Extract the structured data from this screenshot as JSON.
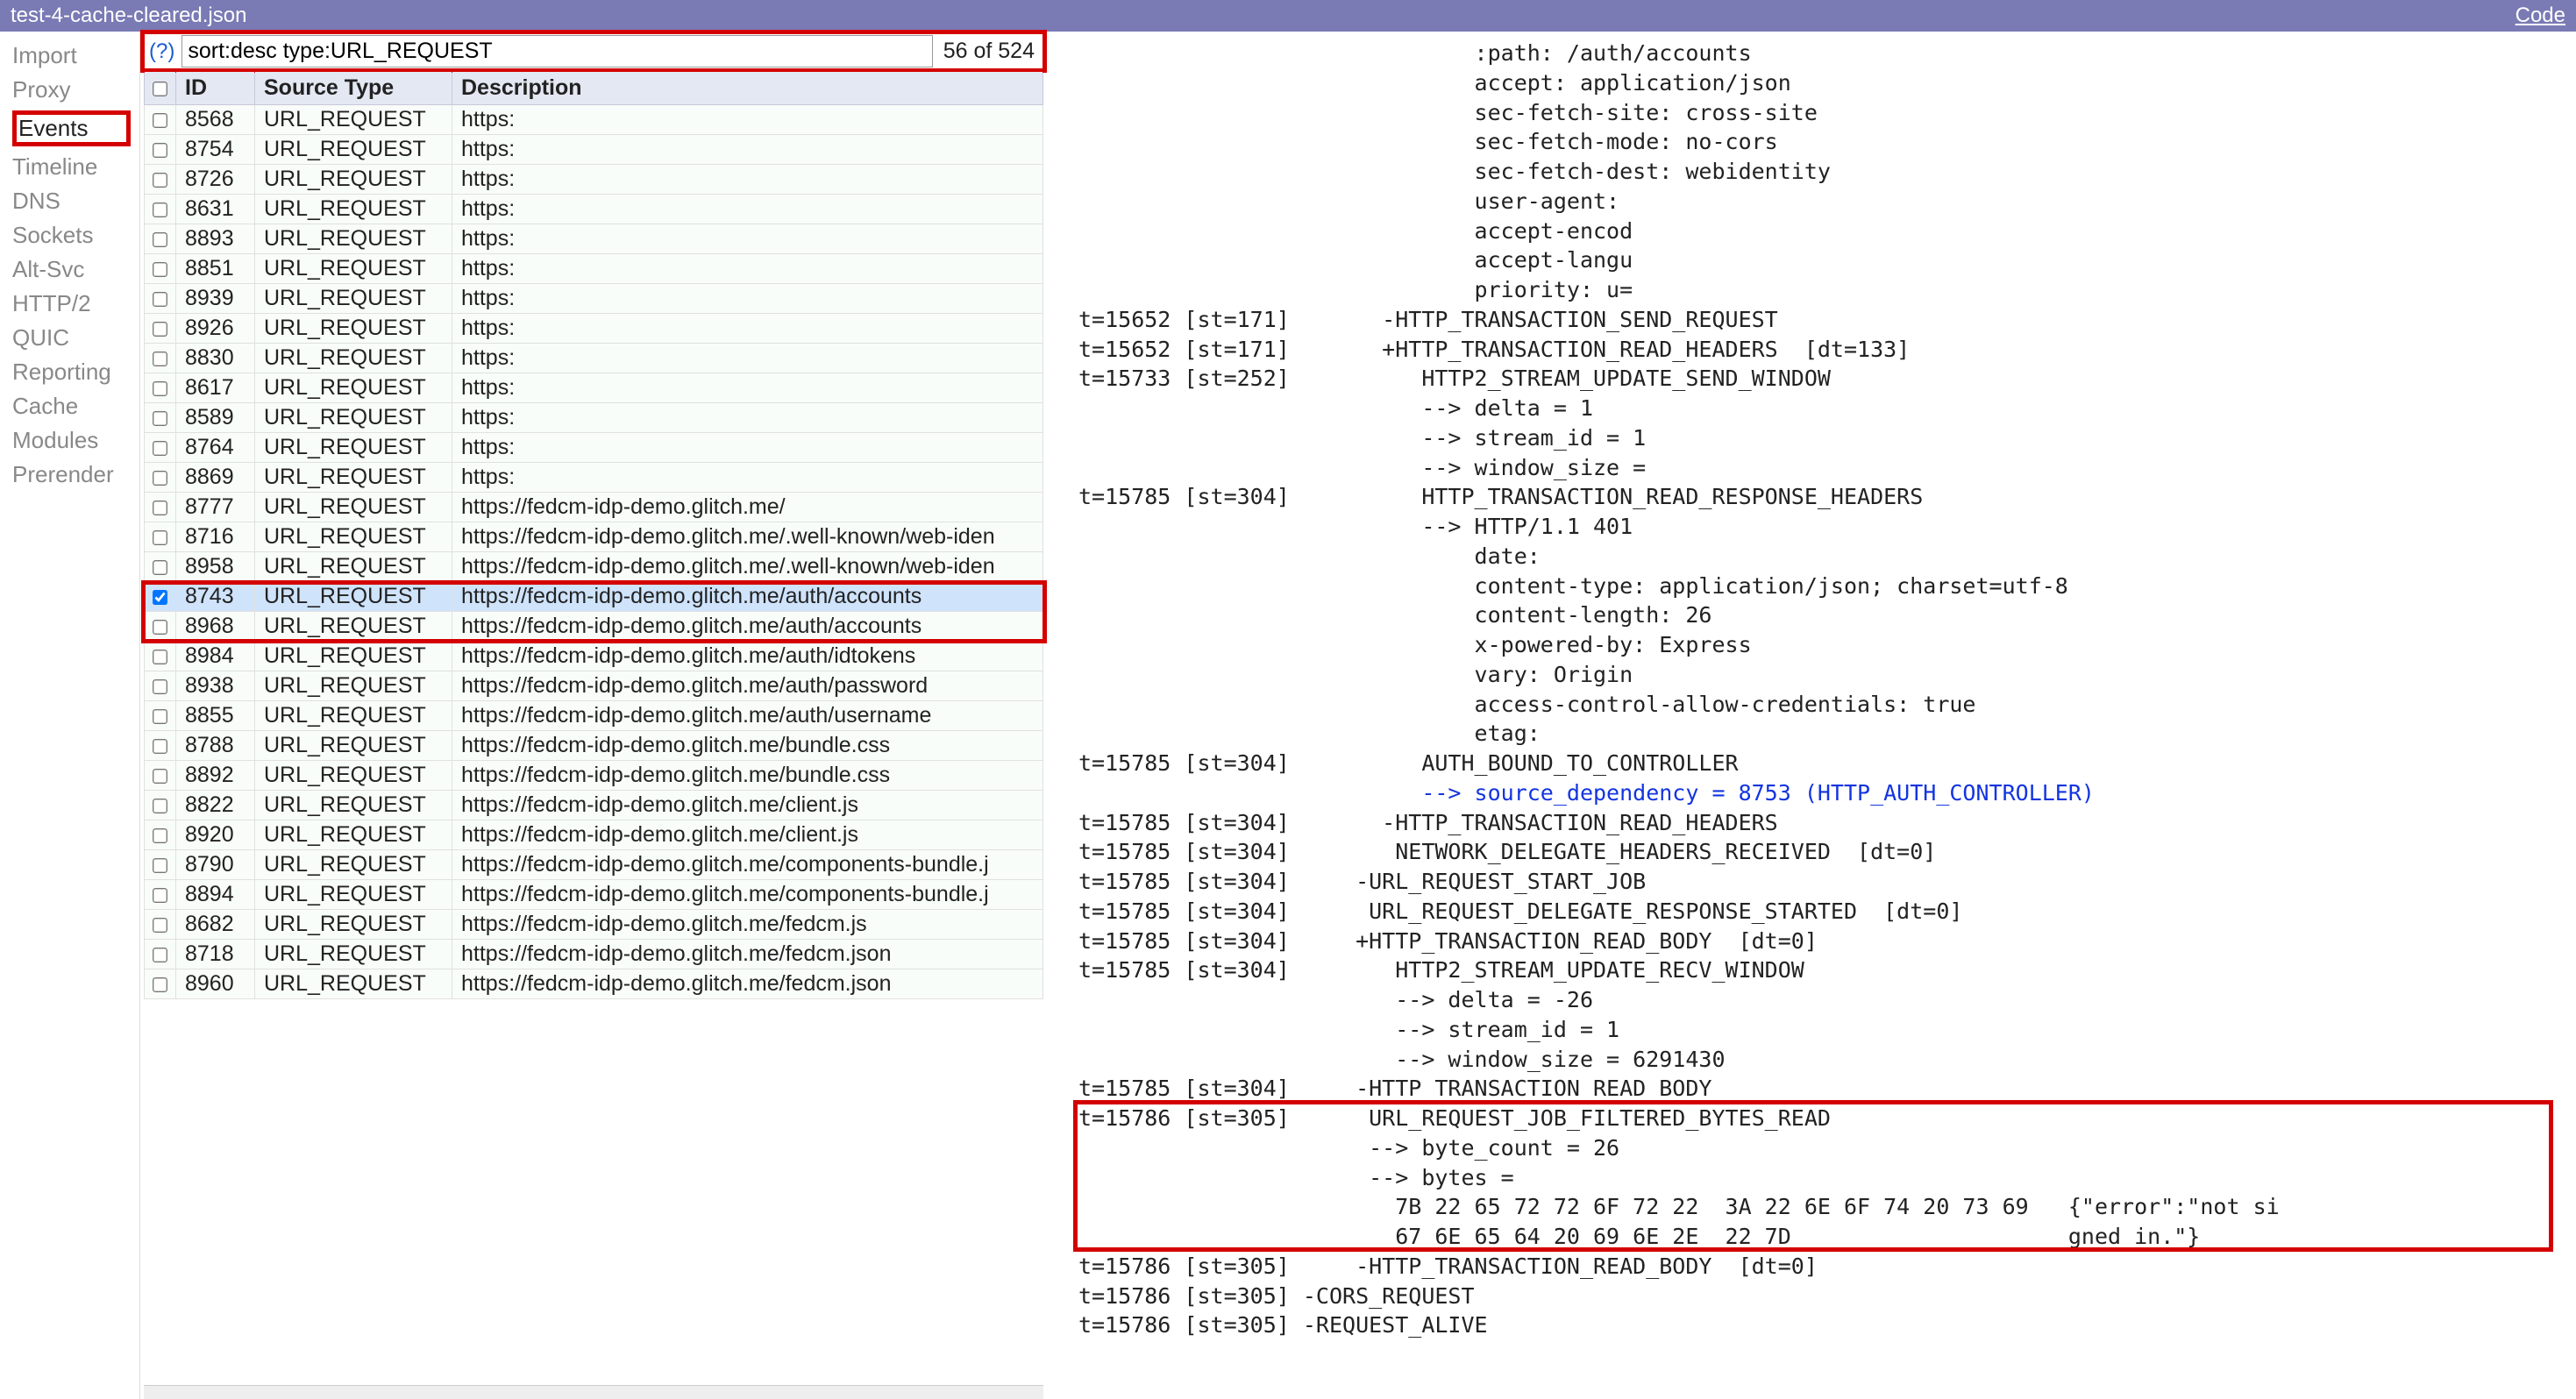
{
  "titlebar": {
    "filename": "test-4-cache-cleared.json",
    "codeLink": "Code"
  },
  "sidebar": {
    "items": [
      "Import",
      "Proxy",
      "Events",
      "Timeline",
      "DNS",
      "Sockets",
      "Alt-Svc",
      "HTTP/2",
      "QUIC",
      "Reporting",
      "Cache",
      "Modules",
      "Prerender"
    ],
    "activeIndex": 2
  },
  "filter": {
    "help": "(?)",
    "value": "sort:desc type:URL_REQUEST",
    "count": "56 of 524"
  },
  "columns": [
    "",
    "ID",
    "Source Type",
    "Description"
  ],
  "rows": [
    {
      "id": "8568",
      "type": "URL_REQUEST",
      "desc": "https:"
    },
    {
      "id": "8754",
      "type": "URL_REQUEST",
      "desc": "https:"
    },
    {
      "id": "8726",
      "type": "URL_REQUEST",
      "desc": "https:"
    },
    {
      "id": "8631",
      "type": "URL_REQUEST",
      "desc": "https:"
    },
    {
      "id": "8893",
      "type": "URL_REQUEST",
      "desc": "https:"
    },
    {
      "id": "8851",
      "type": "URL_REQUEST",
      "desc": "https:"
    },
    {
      "id": "8939",
      "type": "URL_REQUEST",
      "desc": "https:"
    },
    {
      "id": "8926",
      "type": "URL_REQUEST",
      "desc": "https:"
    },
    {
      "id": "8830",
      "type": "URL_REQUEST",
      "desc": "https:"
    },
    {
      "id": "8617",
      "type": "URL_REQUEST",
      "desc": "https:"
    },
    {
      "id": "8589",
      "type": "URL_REQUEST",
      "desc": "https:"
    },
    {
      "id": "8764",
      "type": "URL_REQUEST",
      "desc": "https:"
    },
    {
      "id": "8869",
      "type": "URL_REQUEST",
      "desc": "https:"
    },
    {
      "id": "8777",
      "type": "URL_REQUEST",
      "desc": "https://fedcm-idp-demo.glitch.me/"
    },
    {
      "id": "8716",
      "type": "URL_REQUEST",
      "desc": "https://fedcm-idp-demo.glitch.me/.well-known/web-iden"
    },
    {
      "id": "8958",
      "type": "URL_REQUEST",
      "desc": "https://fedcm-idp-demo.glitch.me/.well-known/web-iden"
    },
    {
      "id": "8743",
      "type": "URL_REQUEST",
      "desc": "https://fedcm-idp-demo.glitch.me/auth/accounts",
      "checked": true
    },
    {
      "id": "8968",
      "type": "URL_REQUEST",
      "desc": "https://fedcm-idp-demo.glitch.me/auth/accounts"
    },
    {
      "id": "8984",
      "type": "URL_REQUEST",
      "desc": "https://fedcm-idp-demo.glitch.me/auth/idtokens"
    },
    {
      "id": "8938",
      "type": "URL_REQUEST",
      "desc": "https://fedcm-idp-demo.glitch.me/auth/password"
    },
    {
      "id": "8855",
      "type": "URL_REQUEST",
      "desc": "https://fedcm-idp-demo.glitch.me/auth/username"
    },
    {
      "id": "8788",
      "type": "URL_REQUEST",
      "desc": "https://fedcm-idp-demo.glitch.me/bundle.css"
    },
    {
      "id": "8892",
      "type": "URL_REQUEST",
      "desc": "https://fedcm-idp-demo.glitch.me/bundle.css"
    },
    {
      "id": "8822",
      "type": "URL_REQUEST",
      "desc": "https://fedcm-idp-demo.glitch.me/client.js"
    },
    {
      "id": "8920",
      "type": "URL_REQUEST",
      "desc": "https://fedcm-idp-demo.glitch.me/client.js"
    },
    {
      "id": "8790",
      "type": "URL_REQUEST",
      "desc": "https://fedcm-idp-demo.glitch.me/components-bundle.j"
    },
    {
      "id": "8894",
      "type": "URL_REQUEST",
      "desc": "https://fedcm-idp-demo.glitch.me/components-bundle.j"
    },
    {
      "id": "8682",
      "type": "URL_REQUEST",
      "desc": "https://fedcm-idp-demo.glitch.me/fedcm.js"
    },
    {
      "id": "8718",
      "type": "URL_REQUEST",
      "desc": "https://fedcm-idp-demo.glitch.me/fedcm.json"
    },
    {
      "id": "8960",
      "type": "URL_REQUEST",
      "desc": "https://fedcm-idp-demo.glitch.me/fedcm.json"
    }
  ],
  "selectedRowIndex": 16,
  "highlightRowStart": 16,
  "highlightRowEnd": 17,
  "detail": {
    "preHeaders": [
      "                              :path: /auth/accounts",
      "                              accept: application/json",
      "                              sec-fetch-site: cross-site",
      "                              sec-fetch-mode: no-cors",
      "                              sec-fetch-dest: webidentity",
      "                              user-agent:",
      "                              accept-encod",
      "                              accept-langu",
      "                              priority: u="
    ],
    "lines": [
      "t=15652 [st=171]       -HTTP_TRANSACTION_SEND_REQUEST",
      "t=15652 [st=171]       +HTTP_TRANSACTION_READ_HEADERS  [dt=133]",
      "t=15733 [st=252]          HTTP2_STREAM_UPDATE_SEND_WINDOW",
      "                          --> delta = 1",
      "                          --> stream_id = 1",
      "                          --> window_size =",
      "t=15785 [st=304]          HTTP_TRANSACTION_READ_RESPONSE_HEADERS",
      "                          --> HTTP/1.1 401",
      "                              date:",
      "                              content-type: application/json; charset=utf-8",
      "                              content-length: 26",
      "                              x-powered-by: Express",
      "                              vary: Origin",
      "                              access-control-allow-credentials: true",
      "                              etag:",
      "t=15785 [st=304]          AUTH_BOUND_TO_CONTROLLER"
    ],
    "linkLine": "                          --> source_dependency = 8753 (HTTP_AUTH_CONTROLLER)",
    "lines2": [
      "t=15785 [st=304]       -HTTP_TRANSACTION_READ_HEADERS",
      "t=15785 [st=304]        NETWORK_DELEGATE_HEADERS_RECEIVED  [dt=0]",
      "t=15785 [st=304]     -URL_REQUEST_START_JOB",
      "t=15785 [st=304]      URL_REQUEST_DELEGATE_RESPONSE_STARTED  [dt=0]",
      "t=15785 [st=304]     +HTTP_TRANSACTION_READ_BODY  [dt=0]",
      "t=15785 [st=304]        HTTP2_STREAM_UPDATE_RECV_WINDOW",
      "                        --> delta = -26",
      "                        --> stream_id = 1",
      "                        --> window_size = 6291430",
      "t=15785 [st=304]     -HTTP_TRANSACTION_READ_BODY"
    ],
    "boxLines": [
      "t=15786 [st=305]      URL_REQUEST_JOB_FILTERED_BYTES_READ",
      "                      --> byte_count = 26",
      "                      --> bytes =",
      "                        7B 22 65 72 72 6F 72 22  3A 22 6E 6F 74 20 73 69   {\"error\":\"not si",
      "                        67 6E 65 64 20 69 6E 2E  22 7D                     gned in.\"}"
    ],
    "lines3": [
      "t=15786 [st=305]     -HTTP_TRANSACTION_READ_BODY  [dt=0]",
      "t=15786 [st=305] -CORS_REQUEST",
      "t=15786 [st=305] -REQUEST_ALIVE"
    ]
  }
}
